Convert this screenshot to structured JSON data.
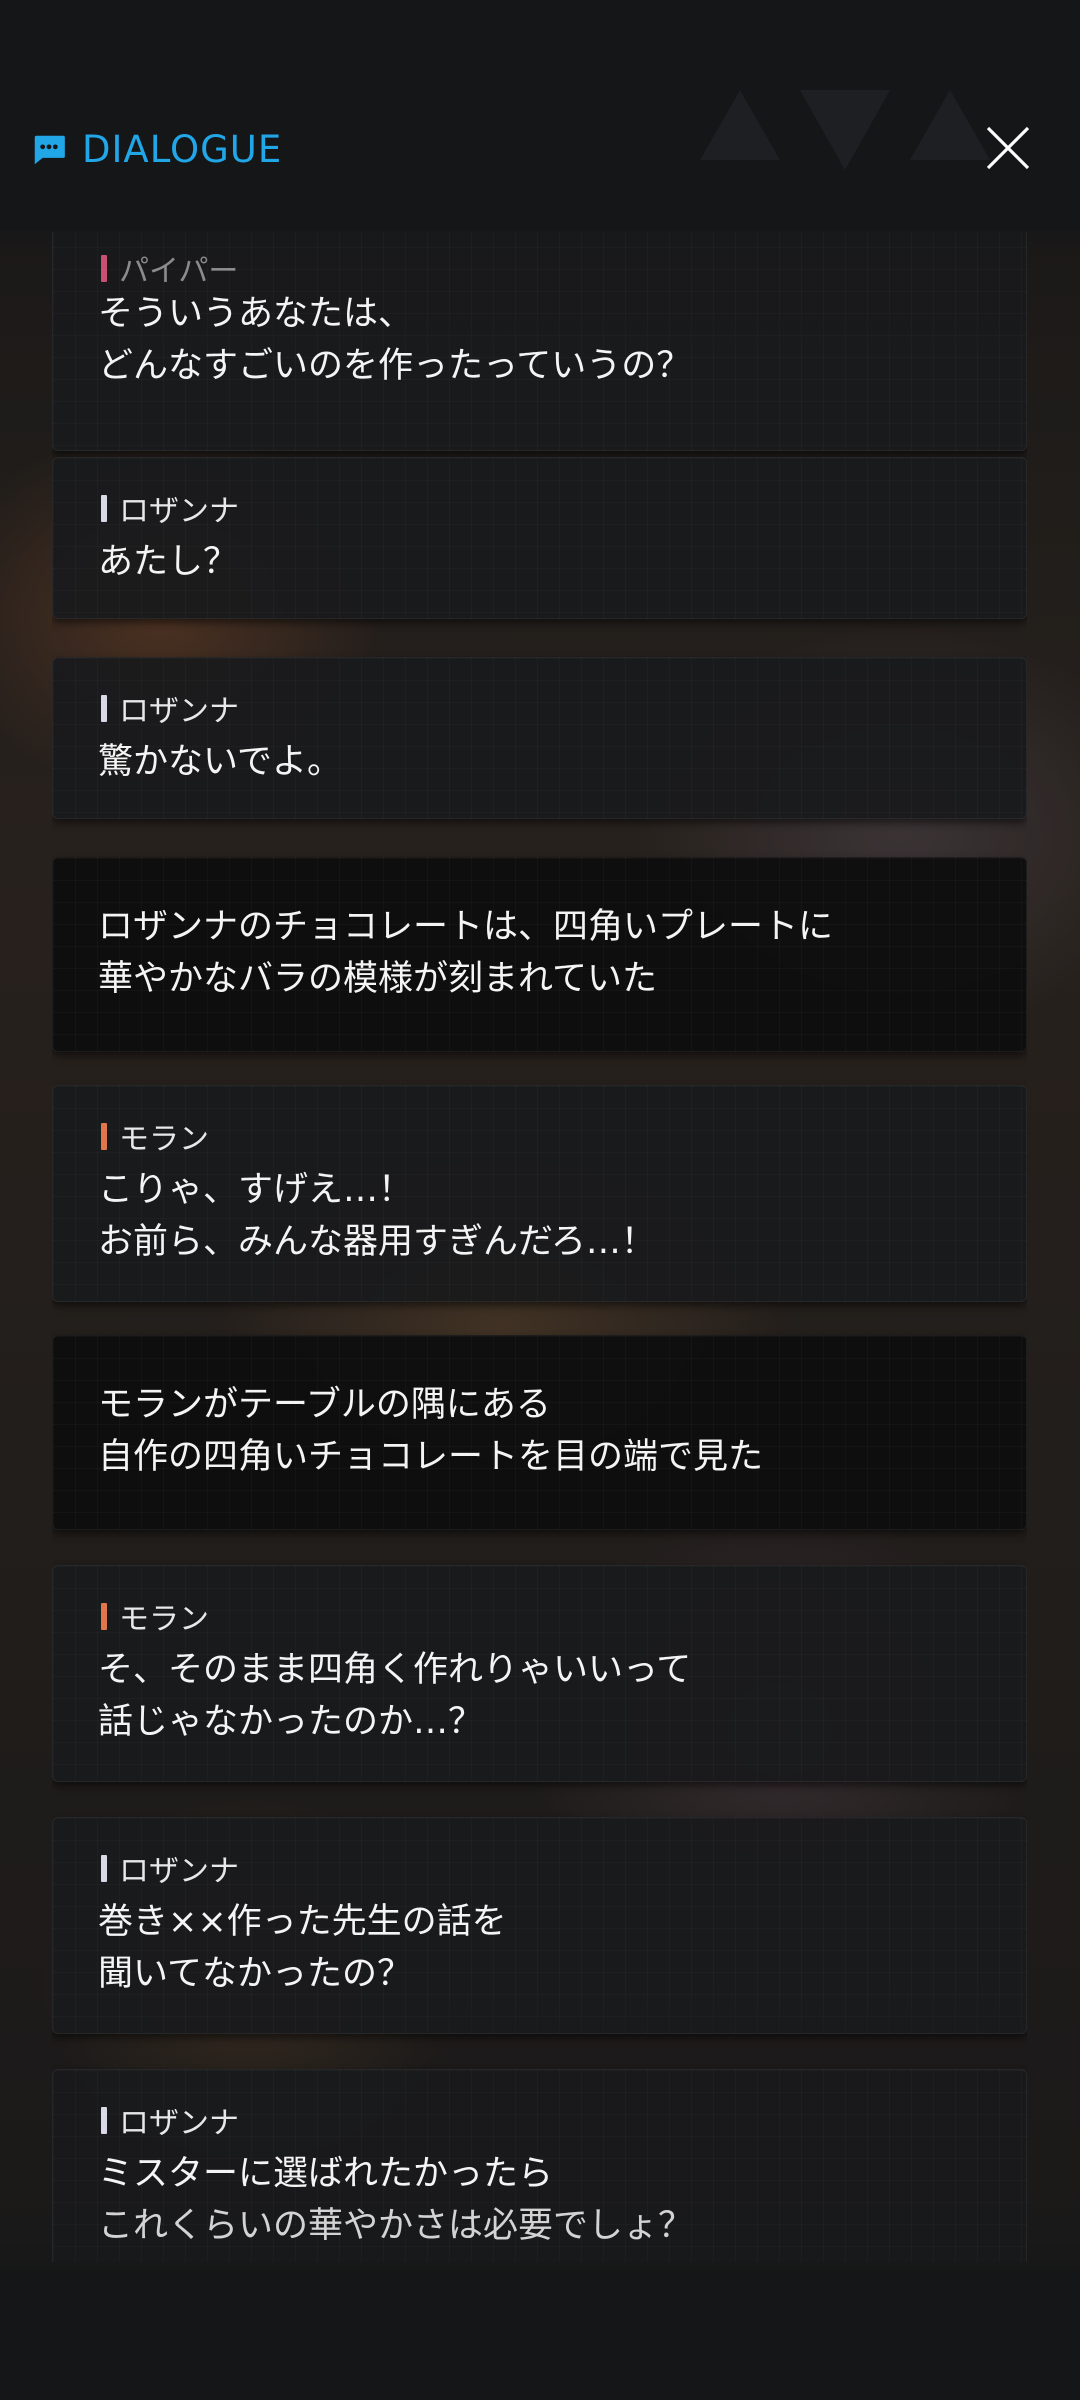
{
  "header": {
    "title": "DIALOGUE",
    "icon": "chat-bubble-icon",
    "close_icon": "close-icon",
    "accent": "#21a6e8"
  },
  "speaker_colors": {
    "piper": "#c94f73",
    "rosanna": "#d8d8e6",
    "moran": "#e0764a"
  },
  "dialogue": [
    {
      "speaker": "パイパー",
      "lines": [
        "そういうあなたは、",
        "どんなすごいのを作ったっていうの？"
      ]
    },
    {
      "speaker": "ロザンナ",
      "lines": [
        "あたし？"
      ]
    },
    {
      "speaker": "ロザンナ",
      "lines": [
        "驚かないでよ。"
      ]
    },
    {
      "speaker": "",
      "lines": [
        "ロザンナのチョコレートは、四角いプレートに",
        "華やかなバラの模様が刻まれていた"
      ]
    },
    {
      "speaker": "モラン",
      "lines": [
        "こりゃ、すげえ…！",
        "お前ら、みんな器用すぎんだろ…！"
      ]
    },
    {
      "speaker": "",
      "lines": [
        "モランがテーブルの隅にある",
        "自作の四角いチョコレートを目の端で見た"
      ]
    },
    {
      "speaker": "モラン",
      "lines": [
        "そ、そのまま四角く作れりゃいいって",
        "話じゃなかったのか…？"
      ]
    },
    {
      "speaker": "ロザンナ",
      "lines": [
        "巻き××作った先生の話を",
        "聞いてなかったの？"
      ]
    },
    {
      "speaker": "ロザンナ",
      "lines": [
        "ミスターに選ばれたかったら",
        "これくらいの華やかさは必要でしょ？"
      ]
    }
  ]
}
